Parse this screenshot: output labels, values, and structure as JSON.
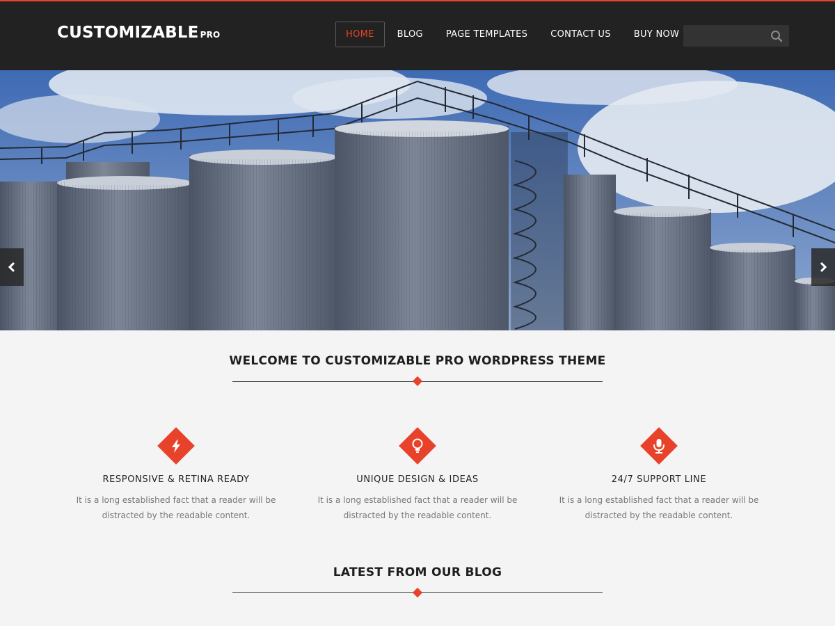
{
  "header": {
    "logo_main": "CUSTOMIZABLE",
    "logo_suffix": "PRO",
    "nav": [
      {
        "label": "HOME",
        "active": true
      },
      {
        "label": "BLOG",
        "active": false
      },
      {
        "label": "PAGE TEMPLATES",
        "active": false
      },
      {
        "label": "CONTACT US",
        "active": false
      },
      {
        "label": "BUY NOW",
        "active": false
      }
    ],
    "search": {
      "value": "",
      "placeholder": "",
      "icon": "search-icon"
    }
  },
  "hero": {
    "image": "industrial silos under blue sky",
    "prev_icon": "chevron-left-icon",
    "next_icon": "chevron-right-icon"
  },
  "welcome": {
    "title": "WELCOME TO CUSTOMIZABLE PRO WORDPRESS THEME"
  },
  "features": [
    {
      "icon": "lightning-icon",
      "title": "RESPONSIVE & RETINA READY",
      "text_line1": "It is a long established fact that a reader will be",
      "text_line2": "distracted by the readable content."
    },
    {
      "icon": "lightbulb-icon",
      "title": "UNIQUE DESIGN & IDEAS",
      "text_line1": "It is a long established fact that a reader will be",
      "text_line2": "distracted by the readable content."
    },
    {
      "icon": "microphone-icon",
      "title": "24/7 SUPPORT LINE",
      "text_line1": "It is a long established fact that a reader will be",
      "text_line2": "distracted by the readable content."
    }
  ],
  "blog": {
    "title": "LATEST FROM OUR BLOG"
  },
  "colors": {
    "accent": "#e8432a",
    "header_bg": "#222222",
    "page_bg": "#f4f4f4"
  }
}
